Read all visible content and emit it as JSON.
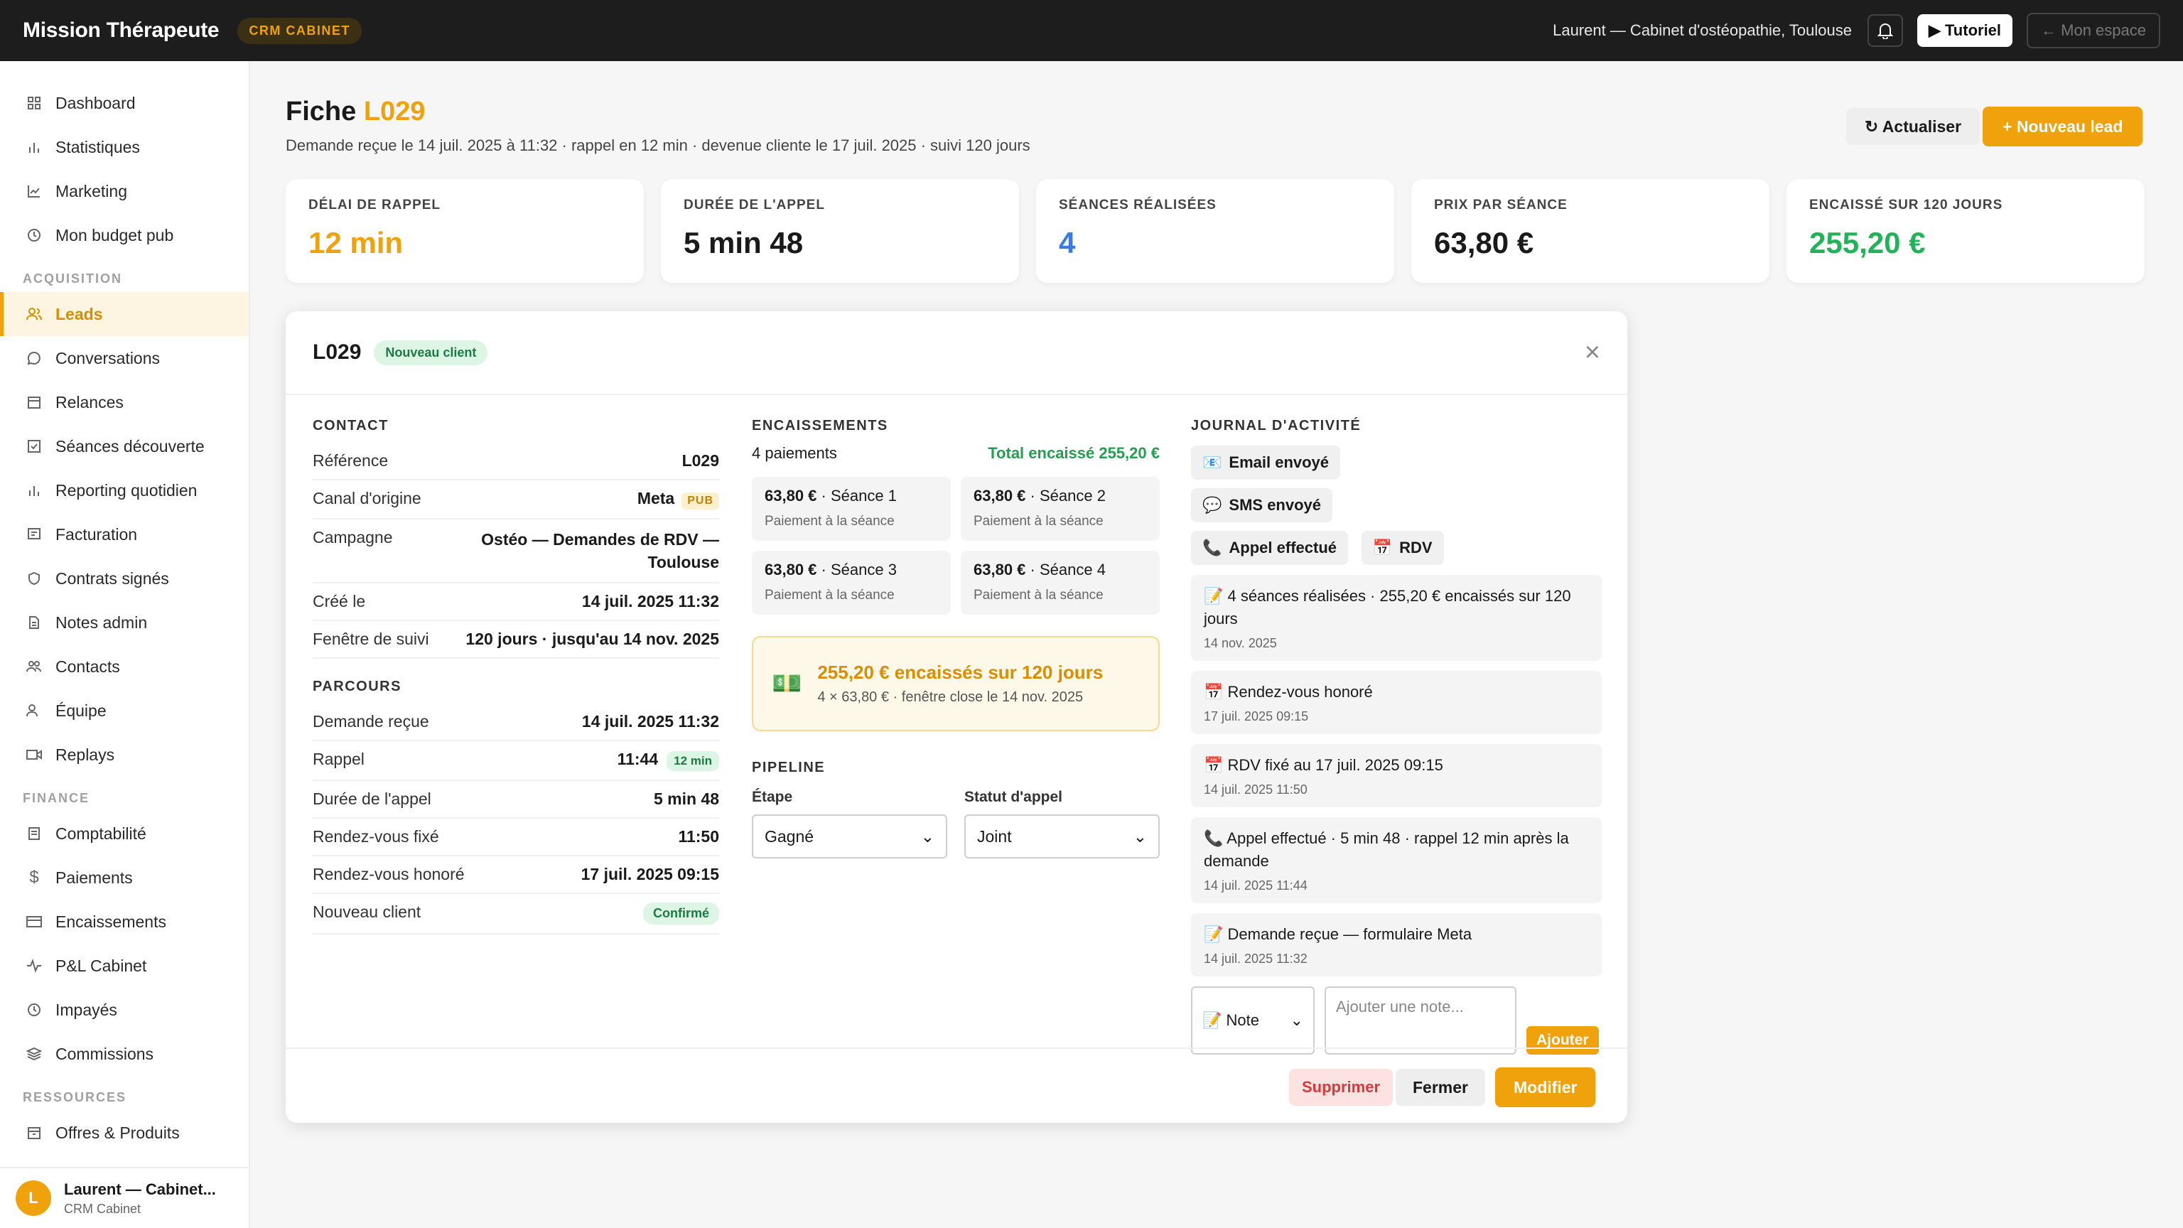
{
  "topbar": {
    "brand": "Mission Thérapeute",
    "badge": "CRM CABINET",
    "user": "Laurent — Cabinet d'ostéopathie, Toulouse",
    "tutorial": "Tutoriel",
    "espace": "← Mon espace"
  },
  "sidebar": {
    "items_top": [
      "Dashboard",
      "Statistiques",
      "Marketing",
      "Mon budget pub"
    ],
    "section_acq": "ACQUISITION",
    "items_acq": [
      "Leads",
      "Conversations",
      "Relances",
      "Séances découverte",
      "Reporting quotidien",
      "Facturation",
      "Contrats signés",
      "Notes admin",
      "Contacts",
      "Équipe",
      "Replays"
    ],
    "section_fin": "FINANCE",
    "items_fin": [
      "Comptabilité",
      "Paiements",
      "Encaissements",
      "P&L Cabinet",
      "Impayés",
      "Commissions"
    ],
    "section_res": "RESSOURCES",
    "items_res": [
      "Offres & Produits"
    ],
    "user": {
      "initial": "L",
      "name": "Laurent — Cabinet...",
      "sub": "CRM Cabinet"
    }
  },
  "page": {
    "title_prefix": "Fiche",
    "title_code": "L029",
    "subtitle": "Demande reçue le 14 juil. 2025 à 11:32 · rappel en 12 min · devenue cliente le 17 juil. 2025 · suivi 120 jours",
    "refresh": "↻ Actualiser",
    "new_lead": "+ Nouveau lead"
  },
  "kpis": [
    {
      "label": "DÉLAI DE RAPPEL",
      "value": "12 min",
      "color": "#f0a20c"
    },
    {
      "label": "DURÉE DE L'APPEL",
      "value": "5 min 48",
      "color": "#1a1a1a"
    },
    {
      "label": "SÉANCES RÉALISÉES",
      "value": "4",
      "color": "#3b7be0"
    },
    {
      "label": "PRIX PAR SÉANCE",
      "value": "63,80 €",
      "color": "#1a1a1a"
    },
    {
      "label": "ENCAISSÉ SUR 120 JOURS",
      "value": "255,20 €",
      "color": "#22b35a"
    }
  ],
  "modal": {
    "title": "L029",
    "badge": "Nouveau client",
    "contact_title": "CONTACT",
    "contact": [
      {
        "k": "Référence",
        "v": "L029"
      },
      {
        "k": "Canal d'origine",
        "v": "Meta",
        "pill": "PUB"
      },
      {
        "k": "Campagne",
        "v": "Ostéo — Demandes de RDV — Toulouse"
      },
      {
        "k": "Créé le",
        "v": "14 juil. 2025 11:32"
      },
      {
        "k": "Fenêtre de suivi",
        "v": "120 jours · jusqu'au 14 nov. 2025"
      }
    ],
    "parcours_title": "PARCOURS",
    "parcours": [
      {
        "k": "Demande reçue",
        "v": "14 juil. 2025 11:32"
      },
      {
        "k": "Rappel",
        "v": "11:44",
        "pill": "12 min"
      },
      {
        "k": "Durée de l'appel",
        "v": "5 min 48"
      },
      {
        "k": "Rendez-vous fixé",
        "v": "11:50"
      },
      {
        "k": "Rendez-vous honoré",
        "v": "17 juil. 2025 09:15"
      },
      {
        "k": "Nouveau client",
        "v": "Confirmé"
      }
    ],
    "enc_title": "ENCAISSEMENTS",
    "enc_count": "4 paiements",
    "enc_total": "Total encaissé 255,20 €",
    "payments": [
      {
        "amount": "63,80 €",
        "label": "· Séance 1",
        "sub": "Paiement à la séance"
      },
      {
        "amount": "63,80 €",
        "label": "· Séance 2",
        "sub": "Paiement à la séance"
      },
      {
        "amount": "63,80 €",
        "label": "· Séance 3",
        "sub": "Paiement à la séance"
      },
      {
        "amount": "63,80 €",
        "label": "· Séance 4",
        "sub": "Paiement à la séance"
      }
    ],
    "callout_icon": "💵",
    "callout_title": "255,20 € encaissés sur 120 jours",
    "callout_sub": "4 × 63,80 € · fenêtre close le 14 nov. 2025",
    "pipeline_title": "PIPELINE",
    "etape_label": "Étape",
    "etape_value": "Gagné",
    "statut_label": "Statut d'appel",
    "statut_value": "Joint",
    "journal_title": "JOURNAL D'ACTIVITÉ",
    "chips": [
      {
        "icon": "📧",
        "label": "Email envoyé"
      },
      {
        "icon": "💬",
        "label": "SMS envoyé"
      },
      {
        "icon": "📞",
        "label": "Appel effectué"
      },
      {
        "icon": "📅",
        "label": "RDV"
      }
    ],
    "activities": [
      {
        "text": "📝 4 séances réalisées · 255,20 € encaissés sur 120 jours",
        "date": "14 nov. 2025"
      },
      {
        "text": "📅 Rendez-vous honoré",
        "date": "17 juil. 2025 09:15"
      },
      {
        "text": "📅 RDV fixé au 17 juil. 2025 09:15",
        "date": "14 juil. 2025 11:50"
      },
      {
        "text": "📞 Appel effectué · 5 min 48 · rappel 12 min après la demande",
        "date": "14 juil. 2025 11:44"
      },
      {
        "text": "📝 Demande reçue — formulaire Meta",
        "date": "14 juil. 2025 11:32"
      }
    ],
    "note_type": "📝 Note",
    "note_placeholder": "Ajouter une note...",
    "add_btn": "Ajouter",
    "delete_btn": "Supprimer",
    "close_btn": "Fermer",
    "edit_btn": "Modifier"
  }
}
